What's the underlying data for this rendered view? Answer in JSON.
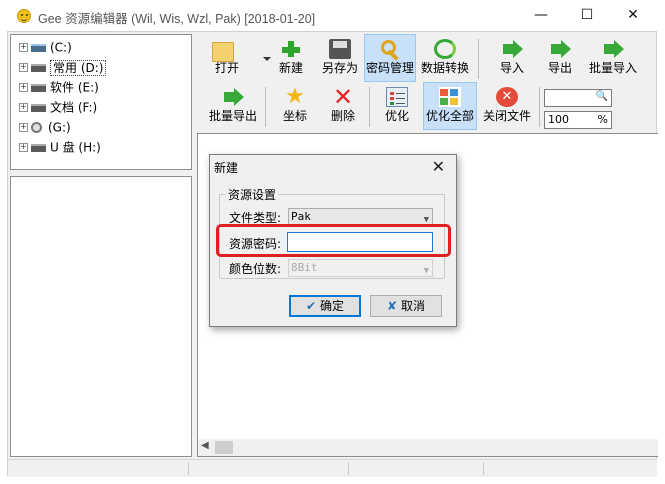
{
  "window": {
    "title": "Gee 资源编辑器 (Wil, Wis, Wzl, Pak) [2018-01-20]",
    "minimize": "—",
    "maximize": "☐",
    "close": "✕"
  },
  "tree": [
    {
      "expander": "+",
      "label": "(C:)",
      "icon": "network-drive-icon"
    },
    {
      "expander": "+",
      "label": "常用 (D:)",
      "icon": "drive-icon",
      "selected": true
    },
    {
      "expander": "+",
      "label": "软件 (E:)",
      "icon": "drive-icon"
    },
    {
      "expander": "+",
      "label": "文档 (F:)",
      "icon": "drive-icon"
    },
    {
      "expander": "+",
      "label": "(G:)",
      "icon": "cd-drive-icon"
    },
    {
      "expander": "+",
      "label": "U 盘 (H:)",
      "icon": "drive-icon"
    }
  ],
  "toolbar": {
    "open": "打开",
    "new": "新建",
    "save_as": "另存为",
    "password_manage": "密码管理",
    "data_convert": "数据转换",
    "import": "导入",
    "export": "导出",
    "batch_import": "批量导入",
    "batch_export": "批量导出",
    "coordinates": "坐标",
    "delete": "删除",
    "optimize": "优化",
    "optimize_all": "优化全部",
    "close_file": "关闭文件",
    "search_value": "",
    "zoom_value": "100",
    "zoom_unit": "%"
  },
  "dialog": {
    "title": "新建",
    "close": "✕",
    "group_title": "资源设置",
    "file_type_label": "文件类型:",
    "file_type_value": "Pak",
    "password_label": "资源密码:",
    "password_value": "",
    "color_depth_label": "颜色位数:",
    "color_depth_value": "8Bit",
    "ok_mark": "✔",
    "ok": "确定",
    "cancel_mark": "✘",
    "cancel": "取消"
  },
  "colors": {
    "highlight": "#e02020",
    "accent": "#0078d7",
    "active_button": "#c9e1f8"
  }
}
